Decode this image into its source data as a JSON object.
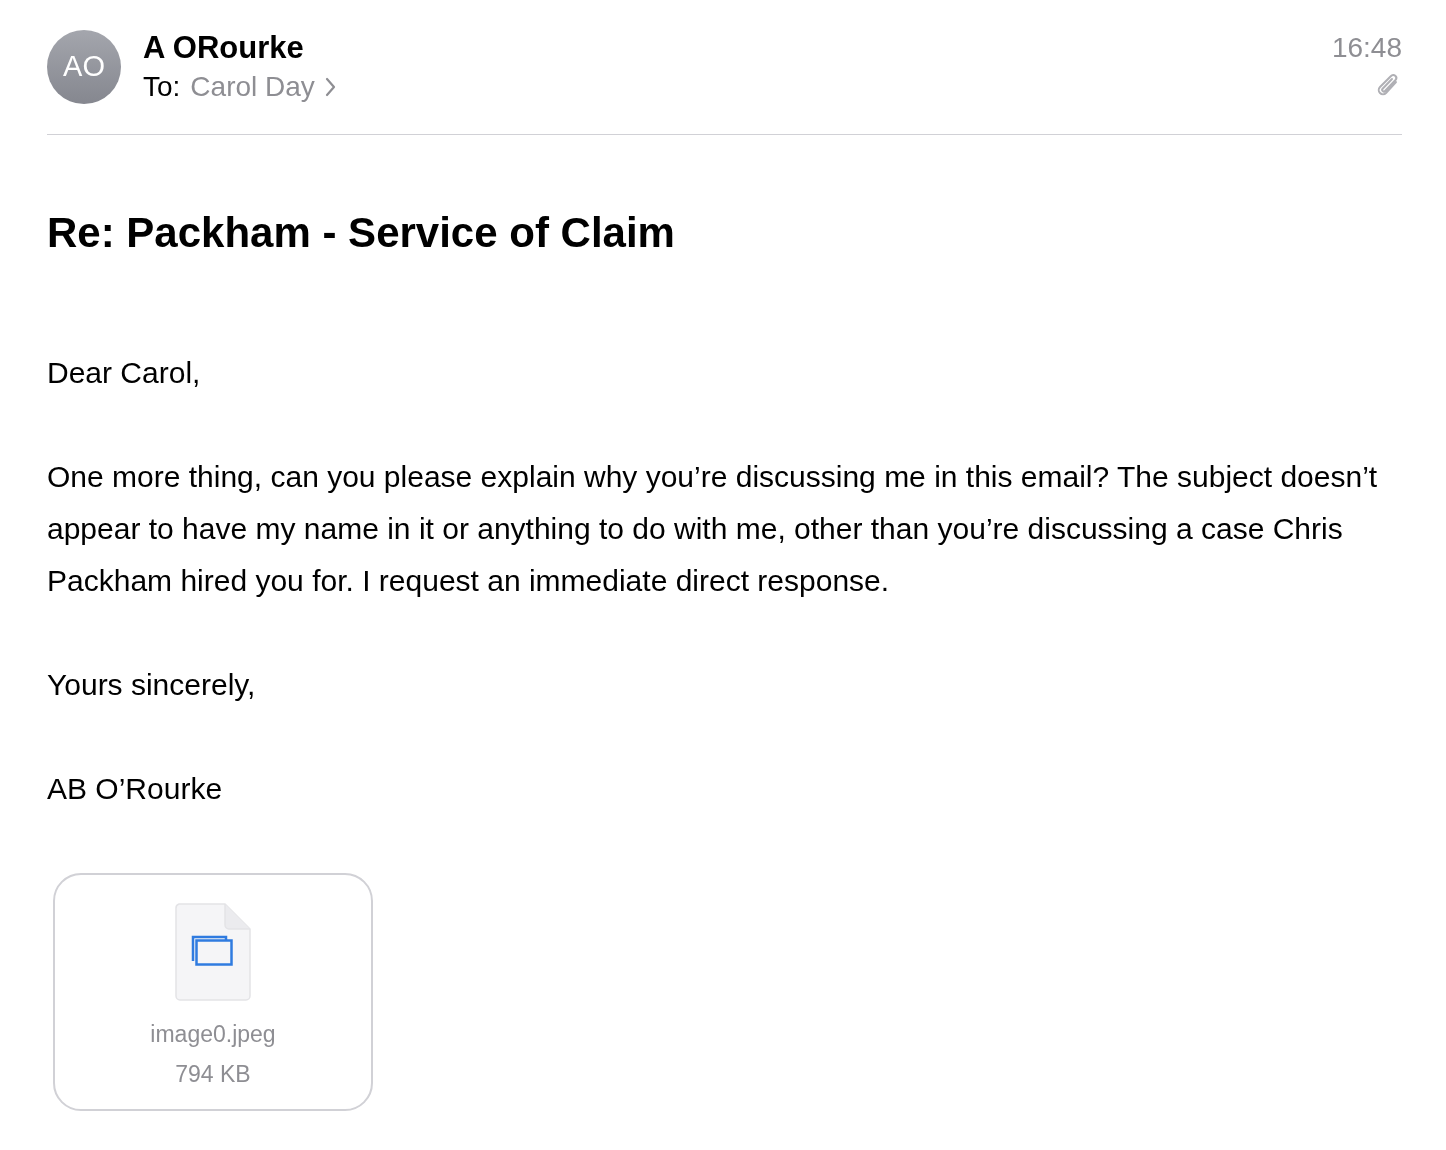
{
  "sender": {
    "initials": "AO",
    "name": "A ORourke",
    "to_label": "To:",
    "recipient": "Carol Day",
    "time": "16:48",
    "has_attachment": true
  },
  "subject": "Re: Packham - Service of Claim",
  "body": [
    "Dear Carol,",
    "One more thing, can you please explain why you’re discussing me in this email? The subject doesn’t appear to have my name in it or anything to do with me, other than you’re discussing a case Chris Packham hired you for. I request an immediate direct response.",
    "Yours sincerely,",
    "AB O’Rourke"
  ],
  "attachments": [
    {
      "name": "image0.jpeg",
      "size": "794 KB"
    }
  ]
}
